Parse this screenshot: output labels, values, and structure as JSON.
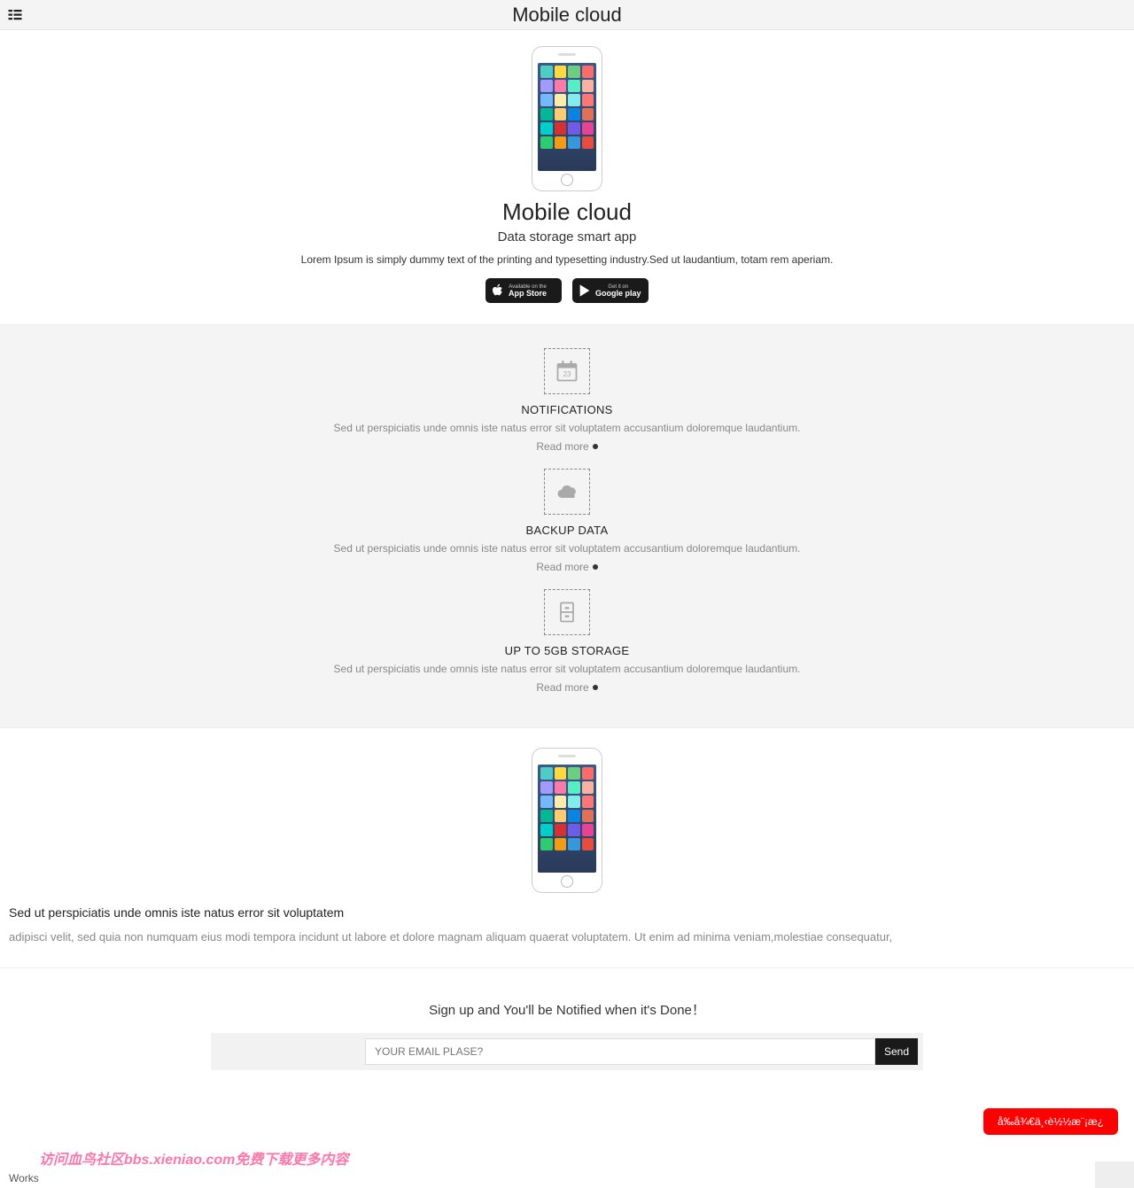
{
  "header": {
    "title": "Mobile cloud"
  },
  "hero": {
    "title": "Mobile cloud",
    "subtitle": "Data storage smart app",
    "desc": "Lorem Ipsum is simply dummy text of the printing and typesetting industry.Sed ut laudantium, totam rem aperiam.",
    "store_apple_small": "Available on the",
    "store_apple": "App Store",
    "store_google_small": "Get it on",
    "store_google": "Google play"
  },
  "features": [
    {
      "title": "NOTIFICATIONS",
      "desc": "Sed ut perspiciatis unde omnis iste natus error sit voluptatem accusantium doloremque laudantium.",
      "read": "Read more"
    },
    {
      "title": "BACKUP DATA",
      "desc": "Sed ut perspiciatis unde omnis iste natus error sit voluptatem accusantium doloremque laudantium.",
      "read": "Read more"
    },
    {
      "title": "UP TO 5GB STORAGE",
      "desc": "Sed ut perspiciatis unde omnis iste natus error sit voluptatem accusantium doloremque laudantium.",
      "read": "Read more"
    }
  ],
  "detail": {
    "title": "Sed ut perspiciatis unde omnis iste natus error sit voluptatem",
    "desc": "adipisci velit, sed quia non numquam eius modi tempora incidunt ut labore et dolore magnam aliquam quaerat voluptatem. Ut enim ad minima veniam,molestiae consequatur,"
  },
  "signup": {
    "title": "Sign up and You'll be Notified when it's Done！",
    "placeholder": "YOUR EMAIL PLASE?",
    "button": "Send"
  },
  "red_button": "å‰å¾€ä¸‹è½½æ¨¡æ¿",
  "footer_promo": "访问血鸟社区bbs.xieniao.com免费下载更多内容",
  "footer_works": "Works",
  "app_colors": [
    "#4ecdc4",
    "#ffd93d",
    "#6bcf7f",
    "#ff6b6b",
    "#a29bfe",
    "#fd79a8",
    "#55efc4",
    "#fab1a0",
    "#74b9ff",
    "#ffeaa7",
    "#81ecec",
    "#ff7675",
    "#00b894",
    "#fdcb6e",
    "#0984e3",
    "#e17055",
    "#00cec9",
    "#d63031",
    "#6c5ce7",
    "#e84393",
    "#2ecc71",
    "#f39c12",
    "#3498db",
    "#e74c3c"
  ]
}
